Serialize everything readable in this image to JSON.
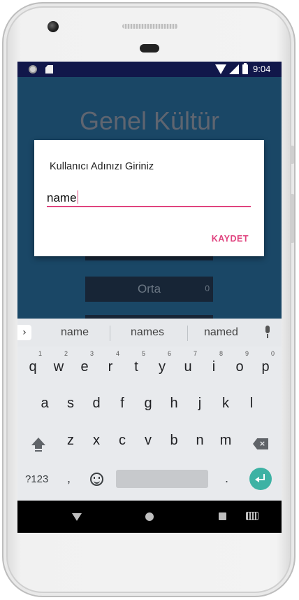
{
  "status_bar": {
    "time": "9:04"
  },
  "app": {
    "title": "Genel Kültür",
    "buttons": [
      {
        "label": "Orta",
        "count": "0"
      }
    ]
  },
  "dialog": {
    "title": "Kullanıcı Adınızı Giriniz",
    "input_value": "name",
    "save_label": "KAYDET",
    "accent_color": "#e0447f"
  },
  "keyboard": {
    "suggestions": [
      "name",
      "names",
      "named"
    ],
    "row1": [
      "q",
      "w",
      "e",
      "r",
      "t",
      "y",
      "u",
      "i",
      "o",
      "p"
    ],
    "row1_hints": [
      "1",
      "2",
      "3",
      "4",
      "5",
      "6",
      "7",
      "8",
      "9",
      "0"
    ],
    "row2": [
      "a",
      "s",
      "d",
      "f",
      "g",
      "h",
      "j",
      "k",
      "l"
    ],
    "row3": [
      "z",
      "x",
      "c",
      "v",
      "b",
      "n",
      "m"
    ],
    "symbols_label": "?123",
    "comma": ",",
    "period": ".",
    "enter_color": "#3db2a4"
  }
}
